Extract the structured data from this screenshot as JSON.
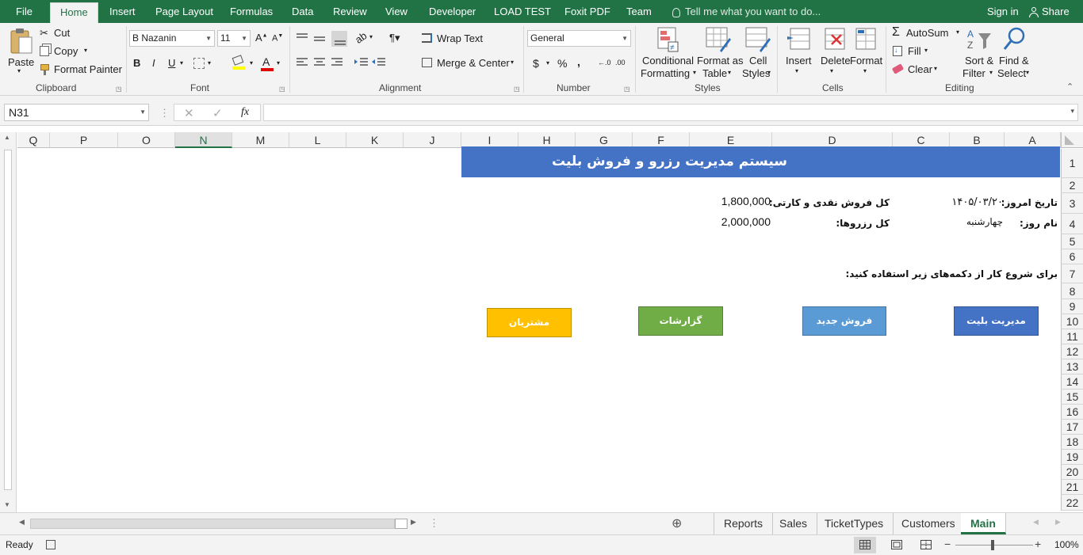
{
  "ribbon_tabs": [
    "File",
    "Home",
    "Insert",
    "Page Layout",
    "Formulas",
    "Data",
    "Review",
    "View",
    "Developer",
    "LOAD TEST",
    "Foxit PDF",
    "Team"
  ],
  "active_tab": "Home",
  "tell_me": "Tell me what you want to do...",
  "sign_in": "Sign in",
  "share": "Share",
  "clipboard": {
    "paste": "Paste",
    "cut": "Cut",
    "copy": "Copy",
    "format_painter": "Format Painter",
    "label": "Clipboard"
  },
  "font": {
    "name": "B Nazanin",
    "size": "11",
    "bold": "B",
    "italic": "I",
    "underline": "U",
    "label": "Font"
  },
  "alignment": {
    "wrap_text": "Wrap Text",
    "merge_center": "Merge & Center",
    "label": "Alignment"
  },
  "number": {
    "format": "General",
    "currency": "$",
    "percent": "%",
    "comma": ",",
    "label": "Number"
  },
  "styles": {
    "conditional": "Conditional",
    "formatting": "Formatting",
    "format_as": "Format as",
    "table": "Table",
    "cell": "Cell",
    "cell_styles": "Styles",
    "label": "Styles"
  },
  "cells": {
    "insert": "Insert",
    "delete": "Delete",
    "format": "Format",
    "label": "Cells"
  },
  "editing": {
    "autosum": "AutoSum",
    "fill": "Fill",
    "clear": "Clear",
    "sort": "Sort &",
    "filter": "Filter",
    "find": "Find &",
    "select": "Select",
    "label": "Editing"
  },
  "formula_bar": {
    "name_box": "N31",
    "fx": "fx",
    "formula": ""
  },
  "columns": [
    "Q",
    "P",
    "O",
    "N",
    "M",
    "L",
    "K",
    "J",
    "I",
    "H",
    "G",
    "F",
    "E",
    "D",
    "C",
    "B",
    "A"
  ],
  "selected_column": "N",
  "rows": [
    "1",
    "2",
    "3",
    "4",
    "5",
    "6",
    "7",
    "8",
    "9",
    "10",
    "11",
    "12",
    "13",
    "14",
    "15",
    "16",
    "17",
    "18",
    "19",
    "20",
    "21",
    "22"
  ],
  "sheet": {
    "title": "سیستم مدیریت رزرو و فروش بلیت",
    "date_label": "تاریخ امروز:",
    "date_value": "۱۴۰۵/۰۳/۲۰",
    "day_label": "نام روز:",
    "day_value": "چهارشنبه",
    "sales_label": "کل فروش نقدی و کارتی:",
    "sales_value": "1,800,000",
    "reservations_label": "کل رزروها:",
    "reservations_value": "2,000,000",
    "instruction": "برای شروع کار از دکمه‌های زیر استفاده کنید:",
    "buttons": {
      "ticket_management": "مدیریت بلیت",
      "new_sale": "فروش جدید",
      "reports": "گزارشات",
      "customers": "مشتریان"
    }
  },
  "sheet_tabs": [
    "Reports",
    "Sales",
    "TicketTypes",
    "Customers",
    "Main"
  ],
  "active_sheet": "Main",
  "status": {
    "ready": "Ready",
    "zoom": "100%"
  },
  "colors": {
    "excel_green": "#217346",
    "title_blue": "#4472c4",
    "btn_blue": "#4472c4",
    "btn_lightblue": "#5b9bd5",
    "btn_green": "#70ad47",
    "btn_gold": "#ffc000"
  }
}
